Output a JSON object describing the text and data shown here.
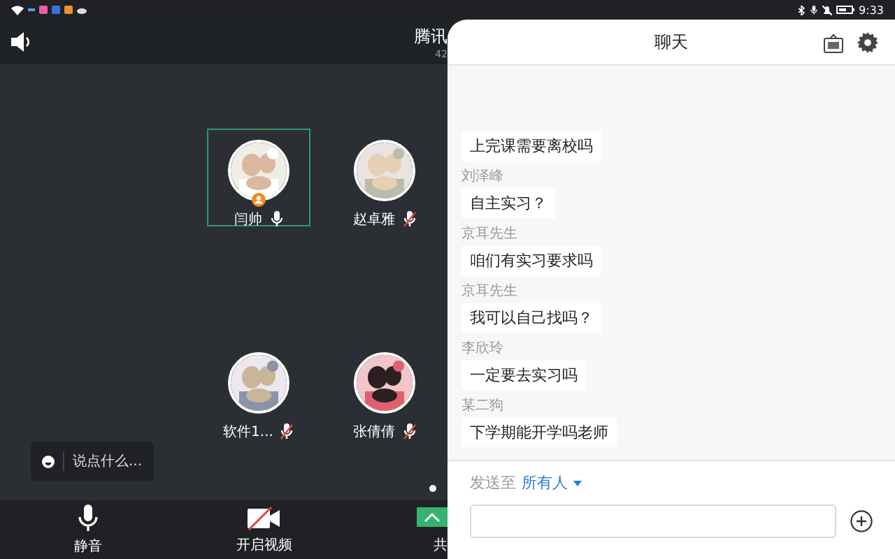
{
  "status_bar": {
    "time": "9:33"
  },
  "meeting": {
    "title": "腾讯",
    "subtitle": "42"
  },
  "participants": [
    {
      "name": "闫帅",
      "selected": true,
      "host": true,
      "muted": false
    },
    {
      "name": "赵卓雅",
      "selected": false,
      "host": false,
      "muted": true
    },
    {
      "name": "软件1...",
      "selected": false,
      "host": false,
      "muted": true
    },
    {
      "name": "张倩倩",
      "selected": false,
      "host": false,
      "muted": true
    }
  ],
  "chat_hint": {
    "placeholder": "说点什么..."
  },
  "page_dots": [
    {
      "selected": true
    }
  ],
  "toolbar": [
    {
      "label": "静音",
      "kind": "mic"
    },
    {
      "label": "开启视频",
      "kind": "camera-off"
    },
    {
      "label": "共",
      "kind": "share"
    }
  ],
  "chat": {
    "title": "聊天",
    "messages": [
      {
        "text": "上完课需要离校吗"
      },
      {
        "sender": "刘泽峰",
        "text": "自主实习？"
      },
      {
        "sender": "京耳先生",
        "text": "咱们有实习要求吗"
      },
      {
        "sender": "京耳先生",
        "text": "我可以自己找吗？"
      },
      {
        "sender": "李欣玲",
        "text": "一定要去实习吗"
      },
      {
        "sender": "某二狗",
        "text": "下学期能开学吗老师"
      }
    ],
    "send_to_label": "发送至",
    "recipient": "所有人"
  }
}
